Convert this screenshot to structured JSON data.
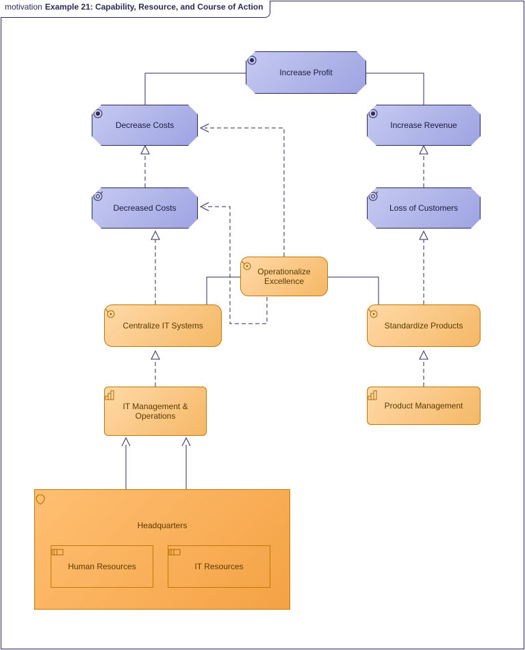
{
  "title_prefix": "motivation",
  "title": "Example 21: Capability, Resource, and Course of Action",
  "nodes": {
    "increase_profit": "Increase Profit",
    "decrease_costs": "Decrease Costs",
    "increase_revenue": "Increase Revenue",
    "decreased_costs": "Decreased Costs",
    "loss_customers": "Loss of Customers",
    "op_excellence": "Operationalize Excellence",
    "centralize_it": "Centralize IT Systems",
    "standardize_products": "Standardize Products",
    "it_mgmt_ops": "IT Management & Operations",
    "product_mgmt": "Product Management",
    "headquarters": "Headquarters",
    "human_resources": "Human Resources",
    "it_resources": "IT Resources"
  }
}
